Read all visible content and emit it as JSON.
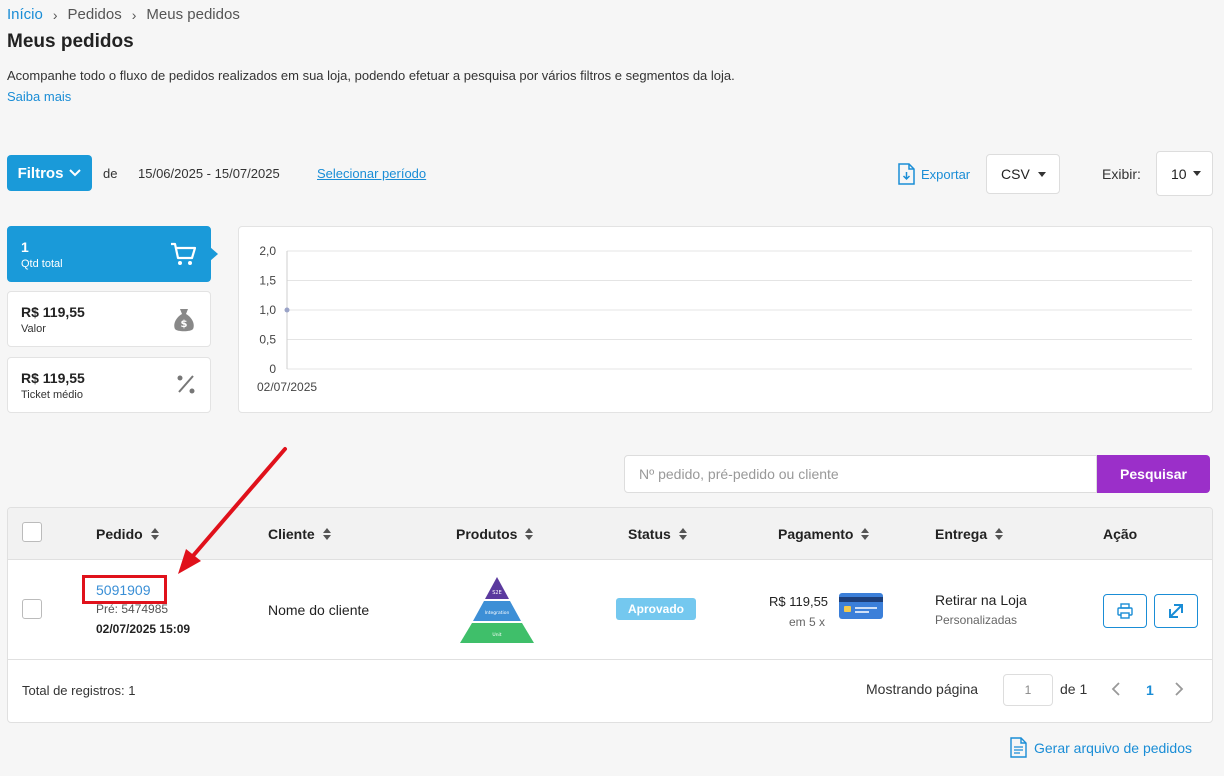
{
  "breadcrumb": {
    "home": "Início",
    "orders": "Pedidos",
    "current": "Meus pedidos"
  },
  "page": {
    "title": "Meus pedidos",
    "description": "Acompanhe todo o fluxo de pedidos realizados em sua loja, podendo efetuar a pesquisa por vários filtros e segmentos da loja.",
    "learn_more": "Saiba mais"
  },
  "toolbar": {
    "filters_label": "Filtros",
    "period_prefix": "de",
    "period_value": "15/06/2025 - 15/07/2025",
    "select_period": "Selecionar período",
    "export_label": "Exportar",
    "export_format": "CSV",
    "show_label": "Exibir:",
    "show_value": "10"
  },
  "summary": {
    "total_qty": {
      "value": "1",
      "label": "Qtd total"
    },
    "total_value": {
      "value": "R$ 119,55",
      "label": "Valor"
    },
    "avg_ticket": {
      "value": "R$ 119,55",
      "label": "Ticket médio"
    }
  },
  "chart_data": {
    "type": "line",
    "x": [
      "02/07/2025"
    ],
    "series": [
      {
        "values": [
          1.0
        ]
      }
    ],
    "ylim": [
      0,
      2
    ],
    "y_ticks": [
      "2,0",
      "1,5",
      "1,0",
      "0,5",
      "0"
    ],
    "grid": true
  },
  "search": {
    "placeholder": "Nº pedido, pré-pedido ou cliente",
    "button": "Pesquisar"
  },
  "table": {
    "columns": [
      "Pedido",
      "Cliente",
      "Produtos",
      "Status",
      "Pagamento",
      "Entrega",
      "Ação"
    ],
    "rows": [
      {
        "order_number": "5091909",
        "pre_order": "Pré: 5474985",
        "date": "02/07/2025 15:09",
        "customer": "Nome do cliente",
        "product_labels": [
          "S2E",
          "Integration",
          "Unit"
        ],
        "status": "Aprovado",
        "payment_value": "R$ 119,55",
        "installments": "em 5 x",
        "delivery": "Retirar na Loja",
        "delivery_type": "Personalizadas"
      }
    ],
    "total_records": "Total de registros: 1",
    "showing_page": "Mostrando página",
    "page_input": "1",
    "of_pages": "de 1",
    "current_page": "1"
  },
  "footer": {
    "generate_file": "Gerar arquivo de pedidos"
  },
  "colors": {
    "primary": "#1a9ad9",
    "search_button": "#9b2fc9",
    "status_approved": "#74c8ef",
    "annotation_red": "#e0111b"
  }
}
